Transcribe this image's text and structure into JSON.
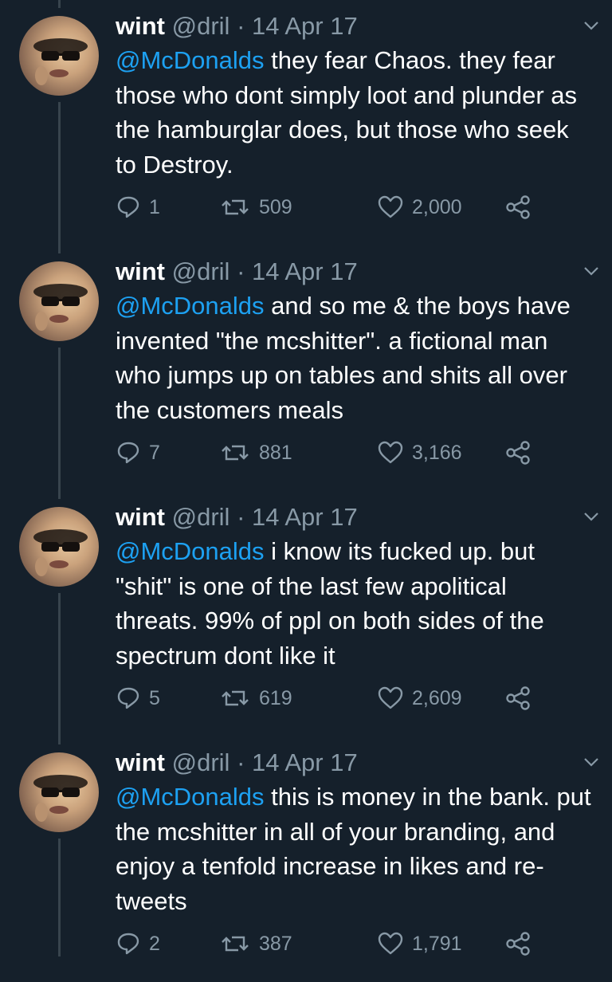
{
  "tweets": [
    {
      "name": "wint",
      "handle": "@dril",
      "date": "· 14 Apr 17",
      "mention": "@McDonalds",
      "text": " they fear Chaos. they fear those who dont simply loot and plunder as the hamburglar does, but those who seek to Destroy.",
      "replies": "1",
      "retweets": "509",
      "likes": "2,000"
    },
    {
      "name": "wint",
      "handle": "@dril",
      "date": "· 14 Apr 17",
      "mention": "@McDonalds",
      "text": " and so me & the boys have invented \"the mcshitter\". a fictional man who jumps up on tables and shits all over the customers meals",
      "replies": "7",
      "retweets": "881",
      "likes": "3,166"
    },
    {
      "name": "wint",
      "handle": "@dril",
      "date": "· 14 Apr 17",
      "mention": "@McDonalds",
      "text": " i know its fucked up. but \"shit\" is one of the last few apolitical threats. 99% of ppl on both sides of the spectrum dont like it",
      "replies": "5",
      "retweets": "619",
      "likes": "2,609"
    },
    {
      "name": "wint",
      "handle": "@dril",
      "date": "· 14 Apr 17",
      "mention": "@McDonalds",
      "text": " this is money in the bank. put the mcshitter in all of your branding, and enjoy a tenfold increase in likes and re-tweets",
      "replies": "2",
      "retweets": "387",
      "likes": "1,791"
    }
  ],
  "icons": {
    "reply": "reply-icon",
    "retweet": "retweet-icon",
    "like": "heart-icon",
    "share": "share-icon",
    "menu": "chevron-down-icon"
  },
  "colors": {
    "background": "#15202b",
    "mention": "#1da1f2",
    "secondary": "#8899a6",
    "thread_line": "#38444d"
  }
}
